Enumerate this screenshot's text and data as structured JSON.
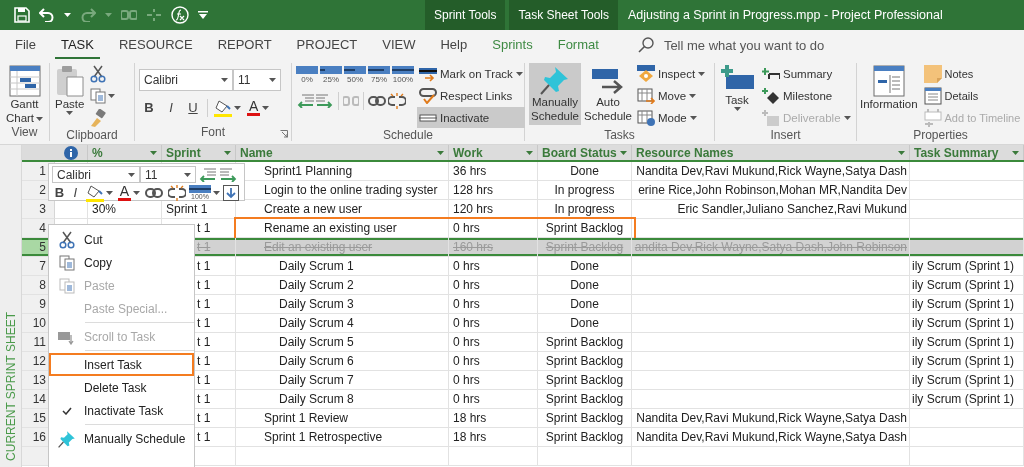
{
  "title_bar": {
    "contextual_tabs": [
      {
        "label": "Sprint Tools"
      },
      {
        "label": "Task Sheet Tools"
      }
    ],
    "title": "Adjusting a Sprint in Progress.mpp - Project Professional"
  },
  "ribbon_tabs": [
    {
      "label": "File",
      "selected": false,
      "kind": "standard"
    },
    {
      "label": "TASK",
      "selected": true,
      "kind": "standard"
    },
    {
      "label": "RESOURCE",
      "selected": false,
      "kind": "standard"
    },
    {
      "label": "REPORT",
      "selected": false,
      "kind": "standard"
    },
    {
      "label": "PROJECT",
      "selected": false,
      "kind": "standard"
    },
    {
      "label": "VIEW",
      "selected": false,
      "kind": "standard"
    },
    {
      "label": "Help",
      "selected": false,
      "kind": "standard"
    },
    {
      "label": "Sprints",
      "selected": false,
      "kind": "contextual"
    },
    {
      "label": "Format",
      "selected": false,
      "kind": "contextual"
    }
  ],
  "tell_me": {
    "placeholder": "Tell me what you want to do"
  },
  "ribbon": {
    "view": {
      "label": "View",
      "gantt": "Gantt Chart"
    },
    "clipboard": {
      "label": "Clipboard",
      "paste": "Paste"
    },
    "font": {
      "label": "Font",
      "font_name": "Calibri",
      "font_size": "11",
      "format_buttons": [
        "B",
        "I",
        "U"
      ],
      "font_color_letter": "A"
    },
    "schedule": {
      "label": "Schedule",
      "percent_buttons": [
        "0%",
        "25%",
        "50%",
        "75%",
        "100%"
      ],
      "buttons": [
        {
          "label": "Mark on Track",
          "selected": false
        },
        {
          "label": "Respect Links",
          "selected": false
        },
        {
          "label": "Inactivate",
          "selected": true
        }
      ]
    },
    "tasks": {
      "label": "Tasks",
      "large_buttons": [
        {
          "label": "Manually Schedule",
          "selected": true
        },
        {
          "label": "Auto Schedule",
          "selected": false
        }
      ],
      "small_buttons": [
        {
          "label": "Inspect"
        },
        {
          "label": "Move"
        },
        {
          "label": "Mode"
        }
      ]
    },
    "insert": {
      "label": "Insert",
      "task": "Task",
      "small_buttons": [
        {
          "label": "Summary",
          "disabled": false
        },
        {
          "label": "Milestone",
          "disabled": false
        },
        {
          "label": "Deliverable",
          "disabled": true
        }
      ]
    },
    "properties": {
      "label": "Properties",
      "information": "Information",
      "small_buttons": [
        {
          "label": "Notes",
          "disabled": false
        },
        {
          "label": "Details",
          "disabled": false
        },
        {
          "label": "Add to Timeline",
          "disabled": true
        }
      ]
    }
  },
  "sheet": {
    "side_label": "CURRENT SPRINT SHEET",
    "columns": [
      {
        "label": "%"
      },
      {
        "label": "Sprint"
      },
      {
        "label": "Name"
      },
      {
        "label": "Work"
      },
      {
        "label": "Board Status"
      },
      {
        "label": "Resource Names"
      },
      {
        "label": "Task Summary"
      }
    ],
    "rows": [
      {
        "id": "1",
        "kind": "task",
        "name": "Sprint1 Planning",
        "work": "36 hrs",
        "status": "Done",
        "resources": "Nandita Dev,Ravi Mukund,Rick Wayne,Satya Dash",
        "selected": false,
        "inactive": false,
        "highlighted": false
      },
      {
        "id": "2",
        "kind": "task",
        "name": "Login to the online trading syster",
        "work": "128 hrs",
        "status": "In progress",
        "resources": "erine Rice,John Robinson,Mohan MR,Nandita Dev",
        "selected": false,
        "inactive": false,
        "highlighted": false
      },
      {
        "id": "3",
        "kind": "task",
        "percent": "30%",
        "sprint": "Sprint 1",
        "name": "Create a new user",
        "work": "120 hrs",
        "status": "In progress",
        "resources": "Eric Sandler,Juliano Sanchez,Ravi Mukund",
        "selected": false,
        "inactive": false,
        "highlighted": false
      },
      {
        "id": "4",
        "kind": "task",
        "sprint": "t 1",
        "name": "Rename an existing user",
        "work": "0 hrs",
        "status": "Sprint Backlog",
        "selected": false,
        "inactive": false,
        "highlighted": true
      },
      {
        "id": "5",
        "kind": "task",
        "sprint": "t 1",
        "name": "Edit an existing user",
        "work": "160 hrs",
        "status": "Sprint Backlog",
        "resources": "andita Dev,Rick Wayne,Satya Dash,John Robinson",
        "selected": true,
        "inactive": true,
        "highlighted": false
      },
      {
        "id": "7",
        "kind": "subtask",
        "sprint": "t 1",
        "name": "Daily Scrum 1",
        "work": "0 hrs",
        "status": "Done",
        "summary": "ily Scrum (Sprint 1)",
        "selected": false,
        "inactive": false,
        "highlighted": false
      },
      {
        "id": "8",
        "kind": "subtask",
        "sprint": "t 1",
        "name": "Daily Scrum 2",
        "work": "0 hrs",
        "status": "Done",
        "summary": "ily Scrum (Sprint 1)",
        "selected": false,
        "inactive": false,
        "highlighted": false
      },
      {
        "id": "9",
        "kind": "subtask",
        "sprint": "t 1",
        "name": "Daily Scrum 3",
        "work": "0 hrs",
        "status": "Done",
        "summary": "ily Scrum (Sprint 1)",
        "selected": false,
        "inactive": false,
        "highlighted": false
      },
      {
        "id": "10",
        "kind": "subtask",
        "sprint": "t 1",
        "name": "Daily Scrum 4",
        "work": "0 hrs",
        "status": "Done",
        "summary": "ily Scrum (Sprint 1)",
        "selected": false,
        "inactive": false,
        "highlighted": false
      },
      {
        "id": "11",
        "kind": "subtask",
        "sprint": "t 1",
        "name": "Daily Scrum 5",
        "work": "0 hrs",
        "status": "Sprint Backlog",
        "summary": "ily Scrum (Sprint 1)",
        "selected": false,
        "inactive": false,
        "highlighted": false
      },
      {
        "id": "12",
        "kind": "subtask",
        "sprint": "t 1",
        "name": "Daily Scrum 6",
        "work": "0 hrs",
        "status": "Sprint Backlog",
        "summary": "ily Scrum (Sprint 1)",
        "selected": false,
        "inactive": false,
        "highlighted": false
      },
      {
        "id": "13",
        "kind": "subtask",
        "sprint": "t 1",
        "name": "Daily Scrum 7",
        "work": "0 hrs",
        "status": "Sprint Backlog",
        "summary": "ily Scrum (Sprint 1)",
        "selected": false,
        "inactive": false,
        "highlighted": false
      },
      {
        "id": "14",
        "kind": "subtask",
        "sprint": "t 1",
        "name": "Daily Scrum 8",
        "work": "0 hrs",
        "status": "Sprint Backlog",
        "summary": "ily Scrum (Sprint 1)",
        "selected": false,
        "inactive": false,
        "highlighted": false
      },
      {
        "id": "15",
        "kind": "task",
        "sprint": "t 1",
        "name": "Sprint 1 Review",
        "work": "18 hrs",
        "status": "Sprint Backlog",
        "resources": "Nandita Dev,Ravi Mukund,Rick Wayne,Satya Dash",
        "selected": false,
        "inactive": false,
        "highlighted": false
      },
      {
        "id": "16",
        "kind": "task",
        "sprint": "t 1",
        "name": "Sprint 1 Retrospective",
        "work": "18 hrs",
        "status": "Sprint Backlog",
        "resources": "Nandita Dev,Ravi Mukund,Rick Wayne,Satya Dash",
        "selected": false,
        "inactive": false,
        "highlighted": false
      }
    ]
  },
  "mini_toolbar": {
    "font_name": "Calibri",
    "font_size": "11",
    "format_buttons": [
      "B",
      "I"
    ],
    "font_color_letter": "A",
    "progress_label": "100%"
  },
  "context_menu": {
    "items": [
      {
        "kind": "item",
        "label": "Cut",
        "disabled": false,
        "checked": false,
        "highlighted": false
      },
      {
        "kind": "item",
        "label": "Copy",
        "disabled": false,
        "checked": false,
        "highlighted": false
      },
      {
        "kind": "item",
        "label": "Paste",
        "disabled": true,
        "checked": false,
        "highlighted": false
      },
      {
        "kind": "item",
        "label": "Paste Special...",
        "disabled": true,
        "checked": false,
        "highlighted": false
      },
      {
        "kind": "separator"
      },
      {
        "kind": "item",
        "label": "Scroll to Task",
        "disabled": true,
        "checked": false,
        "highlighted": false
      },
      {
        "kind": "separator"
      },
      {
        "kind": "item",
        "label": "Insert Task",
        "disabled": false,
        "checked": false,
        "highlighted": true
      },
      {
        "kind": "item",
        "label": "Delete Task",
        "disabled": false,
        "checked": false,
        "highlighted": false
      },
      {
        "kind": "item",
        "label": "Inactivate Task",
        "disabled": false,
        "checked": true,
        "highlighted": false
      },
      {
        "kind": "separator"
      },
      {
        "kind": "item",
        "label": "Manually Schedule",
        "disabled": false,
        "checked": false,
        "highlighted": false
      }
    ]
  }
}
